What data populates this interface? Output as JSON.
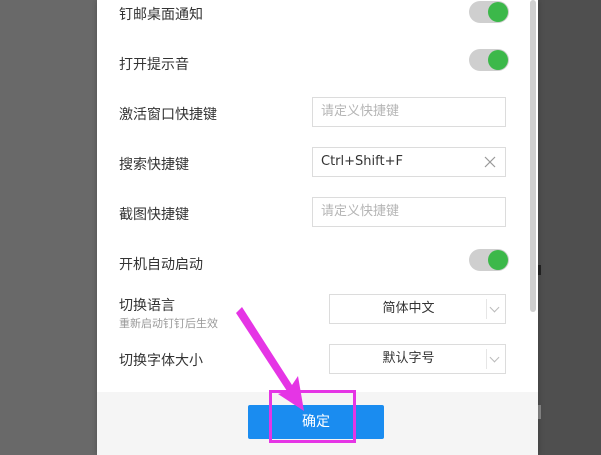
{
  "settings": {
    "rows": [
      {
        "label": "钉邮桌面通知"
      },
      {
        "label": "打开提示音"
      },
      {
        "label": "激活窗口快捷键",
        "placeholder": "请定义快捷键"
      },
      {
        "label": "搜索快捷键",
        "value": "Ctrl+Shift+F"
      },
      {
        "label": "截图快捷键",
        "placeholder": "请定义快捷键"
      },
      {
        "label": "开机自动启动"
      },
      {
        "label": "切换语言",
        "sublabel": "重新启动钉钉后生效",
        "selected": "简体中文"
      },
      {
        "label": "切换字体大小",
        "selected": "默认字号"
      }
    ]
  },
  "footer": {
    "confirm_label": "确定"
  },
  "colors": {
    "toggle_on": "#3cb84a",
    "primary": "#1a8cf0",
    "annotation": "#e535e5"
  },
  "icons": {
    "clear": "close-icon",
    "dropdown": "chevron-down-icon"
  }
}
